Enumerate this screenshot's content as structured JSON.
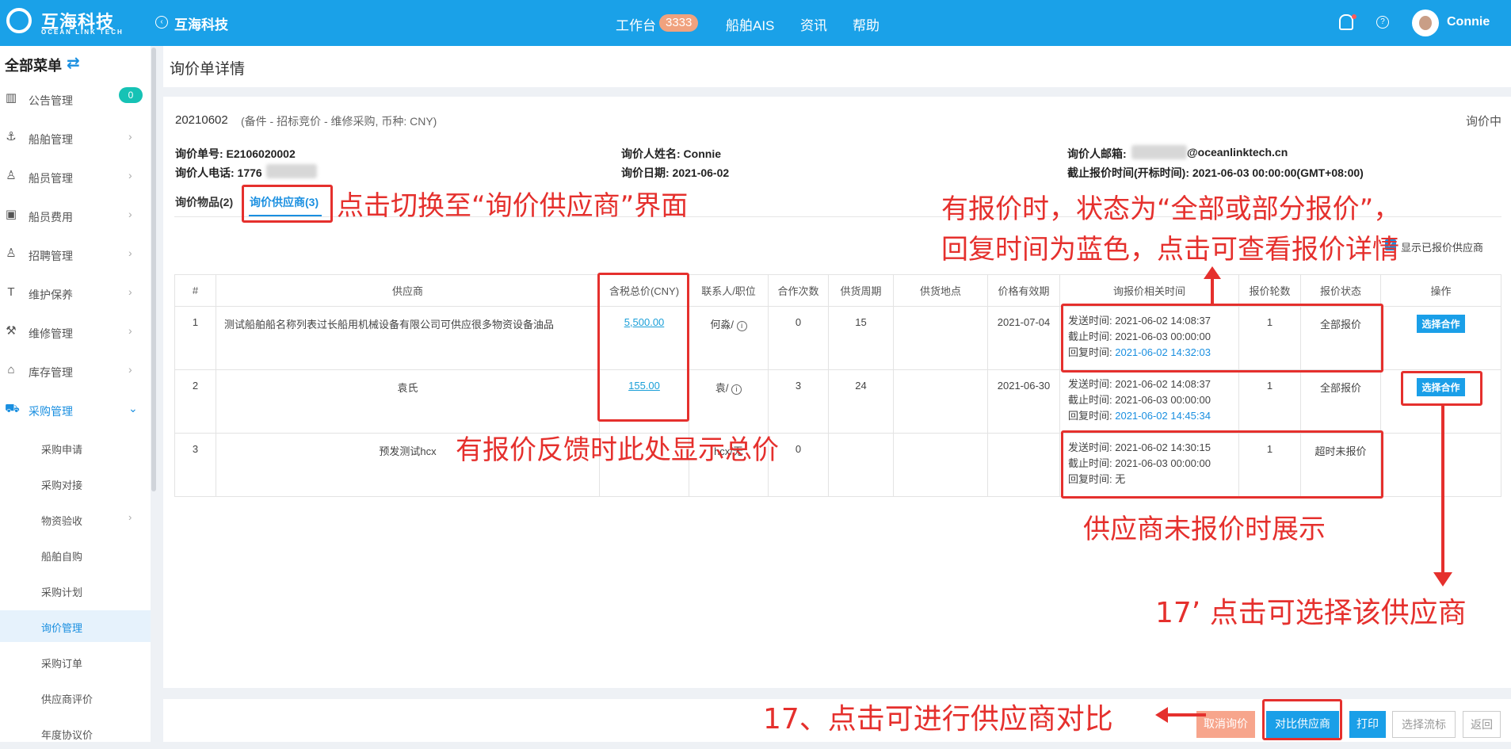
{
  "header": {
    "logo_cn": "互海科技",
    "logo_en": "OCEAN LINK TECH",
    "back_icon": "‹",
    "title": "互海科技",
    "nav": [
      "工作台",
      "船舶AIS",
      "资讯",
      "帮助"
    ],
    "workbench_badge": "3333",
    "help_icon": "?",
    "user": "Connie"
  },
  "sidebar": {
    "title": "全部菜单",
    "swap_icon": "⇄",
    "notice_badge": "0",
    "items": [
      {
        "icon": "▥",
        "label": "公告管理"
      },
      {
        "icon": "⚓",
        "label": "船舶管理"
      },
      {
        "icon": "♙",
        "label": "船员管理"
      },
      {
        "icon": "▣",
        "label": "船员费用"
      },
      {
        "icon": "♙",
        "label": "招聘管理"
      },
      {
        "icon": "T",
        "label": "维护保养"
      },
      {
        "icon": "⚒",
        "label": "维修管理"
      },
      {
        "icon": "⌂",
        "label": "库存管理"
      },
      {
        "icon": "⛟",
        "label": "采购管理"
      }
    ],
    "sub_items": [
      "采购申请",
      "采购对接",
      "物资验收",
      "船舶自购",
      "采购计划",
      "询价管理",
      "采购订单",
      "供应商评价",
      "年度协议价"
    ]
  },
  "page": {
    "title": "询价单详情",
    "code": "20210602",
    "subinfo": "(备件 - 招标竞价 - 维修采购, 币种: CNY)",
    "status": "询价中",
    "info": {
      "inquiry_no": "询价单号: E2106020002",
      "phone": "询价人电话: 1776",
      "name": "询价人姓名: Connie",
      "date": "询价日期: 2021-06-02",
      "email_label": "询价人邮箱:",
      "email_domain": "@oceanlinktech.cn",
      "deadline": "截止报价时间(开标时间): 2021-06-03 00:00:00(GMT+08:00)"
    },
    "tabs": [
      "询价物品(2)",
      "询价供应商(3)"
    ],
    "show_only_label": "显示已报价供应商",
    "table": {
      "headers": [
        "#",
        "供应商",
        "含税总价(CNY)",
        "联系人/职位",
        "合作次数",
        "供货周期",
        "供货地点",
        "价格有效期",
        "询报价相关时间",
        "报价轮数",
        "报价状态",
        "操作"
      ],
      "rows": [
        {
          "no": "1",
          "supplier": "测试船舶船名称列表过长船用机械设备有限公司可供应很多物资设备油品",
          "price": "5,500.00",
          "contact": "何淼/",
          "times": "0",
          "cycle": "15",
          "place": "",
          "valid": "2021-07-04",
          "send": "发送时间: 2021-06-02 14:08:37",
          "deadline": "截止时间: 2021-06-03 00:00:00",
          "reply_label": "回复时间: ",
          "reply": "2021-06-02 14:32:03",
          "rounds": "1",
          "state": "全部报价",
          "action": "选择合作"
        },
        {
          "no": "2",
          "supplier": "袁氏",
          "price": "155.00",
          "contact": "袁/",
          "times": "3",
          "cycle": "24",
          "place": "",
          "valid": "2021-06-30",
          "send": "发送时间: 2021-06-02 14:08:37",
          "deadline": "截止时间: 2021-06-03 00:00:00",
          "reply_label": "回复时间: ",
          "reply": "2021-06-02 14:45:34",
          "rounds": "1",
          "state": "全部报价",
          "action": "选择合作"
        },
        {
          "no": "3",
          "supplier": "预发测试hcx",
          "price": "",
          "contact": "hcx/无",
          "times": "0",
          "cycle": "",
          "place": "",
          "valid": "",
          "send": "发送时间: 2021-06-02 14:30:15",
          "deadline": "截止时间: 2021-06-03 00:00:00",
          "reply_label": "回复时间: ",
          "reply": "无",
          "rounds": "1",
          "state": "超时未报价",
          "action": ""
        }
      ]
    }
  },
  "footer": {
    "cancel": "取消询价",
    "compare": "对比供应商",
    "print": "打印",
    "flow": "选择流标",
    "back": "返回"
  },
  "annotations": {
    "tab_note": "点击切换至“询价供应商”界面",
    "reply_note_1": "有报价时，状态为“全部或部分报价”，",
    "reply_note_2": "回复时间为蓝色，点击可查看报价详情",
    "price_note": "有报价反馈时此处显示总价",
    "no_quote_note": "供应商未报价时展示",
    "select_note": "17’ 点击可选择该供应商",
    "compare_note": "17、点击可进行供应商对比"
  },
  "colors": {
    "topbar": "#1aa1e8",
    "accent": "#1a8fe0",
    "annotation_red": "#e5302d"
  }
}
